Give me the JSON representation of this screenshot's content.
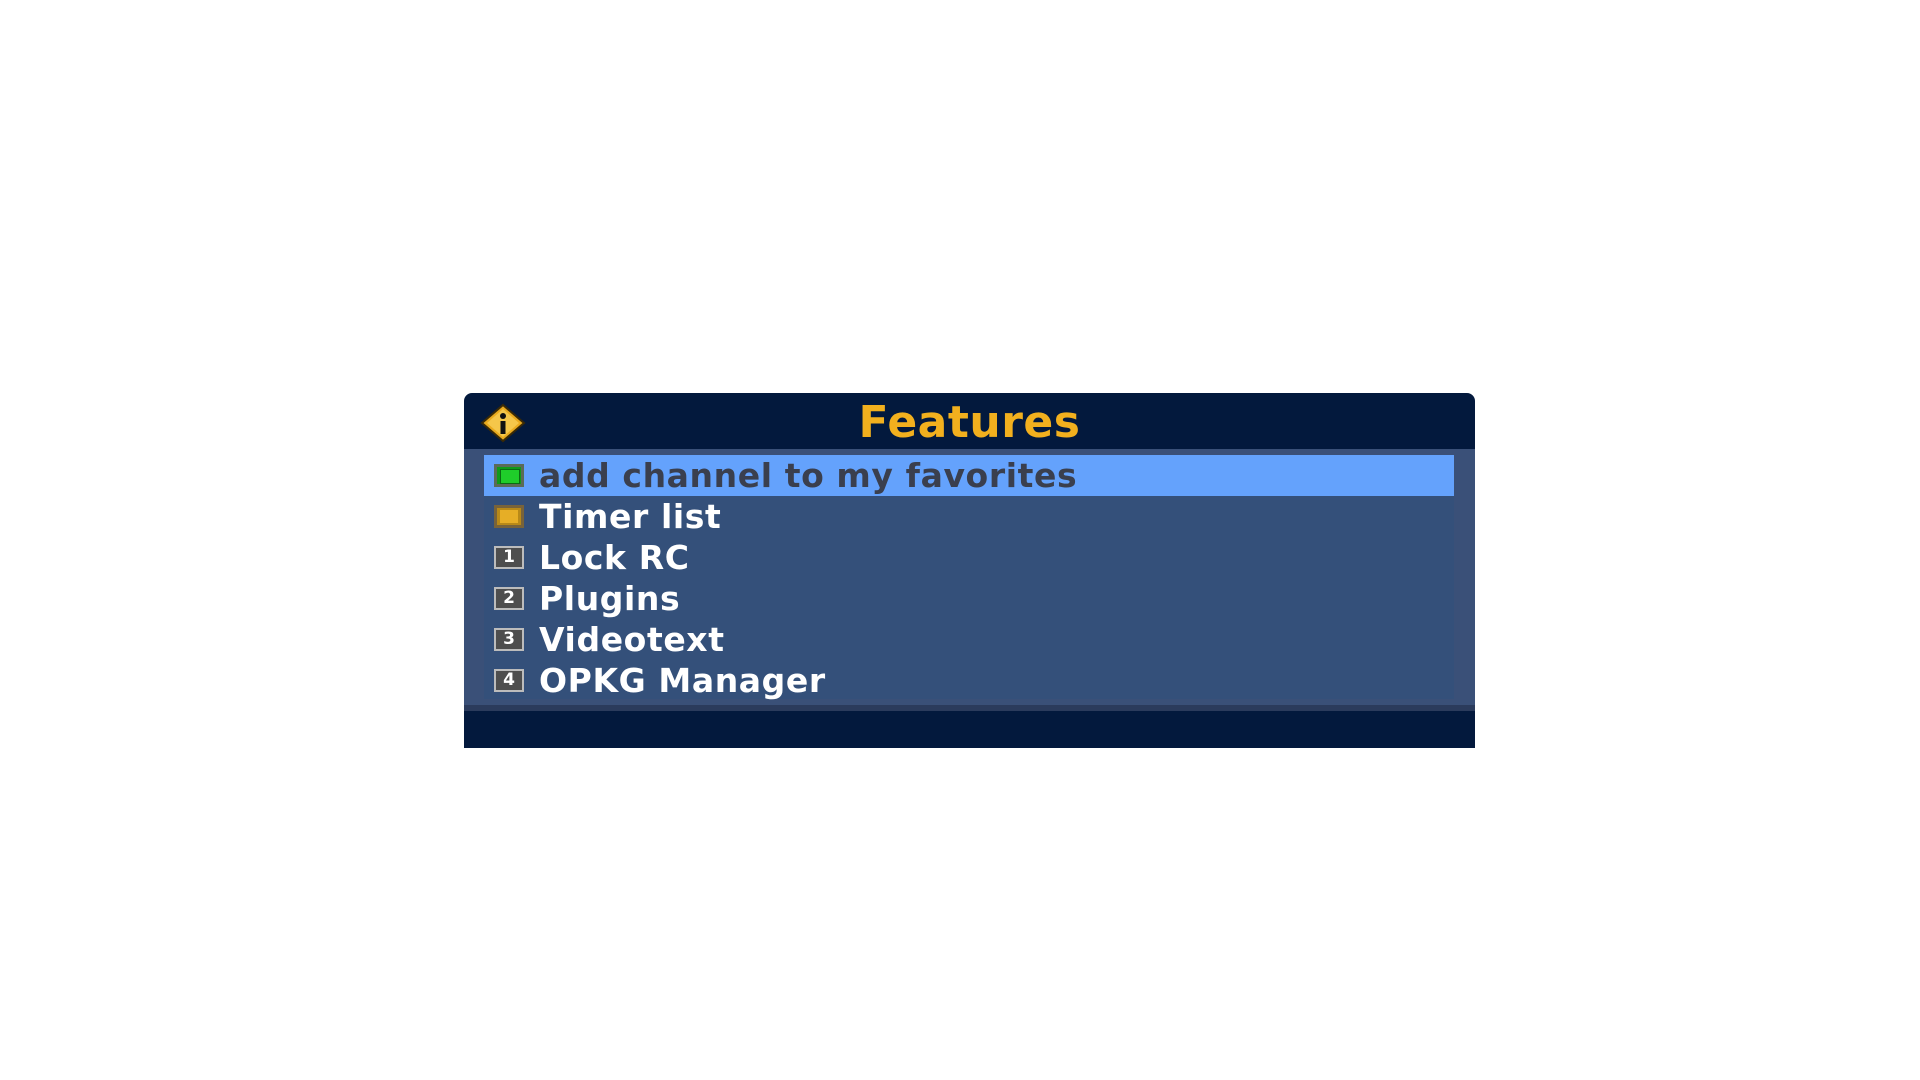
{
  "window": {
    "title": "Features",
    "title_icon": "info-icon",
    "title_color": "#f2b01e"
  },
  "menu": {
    "items": [
      {
        "label": "add channel to my favorites",
        "key": "green-key-icon",
        "key_text": "",
        "selected": true
      },
      {
        "label": "Timer list",
        "key": "yellow-key-icon",
        "key_text": "",
        "selected": false
      },
      {
        "label": "Lock RC",
        "key": "number-key-icon",
        "key_text": "1",
        "selected": false
      },
      {
        "label": "Plugins",
        "key": "number-key-icon",
        "key_text": "2",
        "selected": false
      },
      {
        "label": "Videotext",
        "key": "number-key-icon",
        "key_text": "3",
        "selected": false
      },
      {
        "label": "OPKG Manager",
        "key": "number-key-icon",
        "key_text": "4",
        "selected": false
      }
    ]
  },
  "colors": {
    "header_bg": "#03193d",
    "list_bg": "#34507a",
    "selection_bg": "#64a2fc"
  }
}
